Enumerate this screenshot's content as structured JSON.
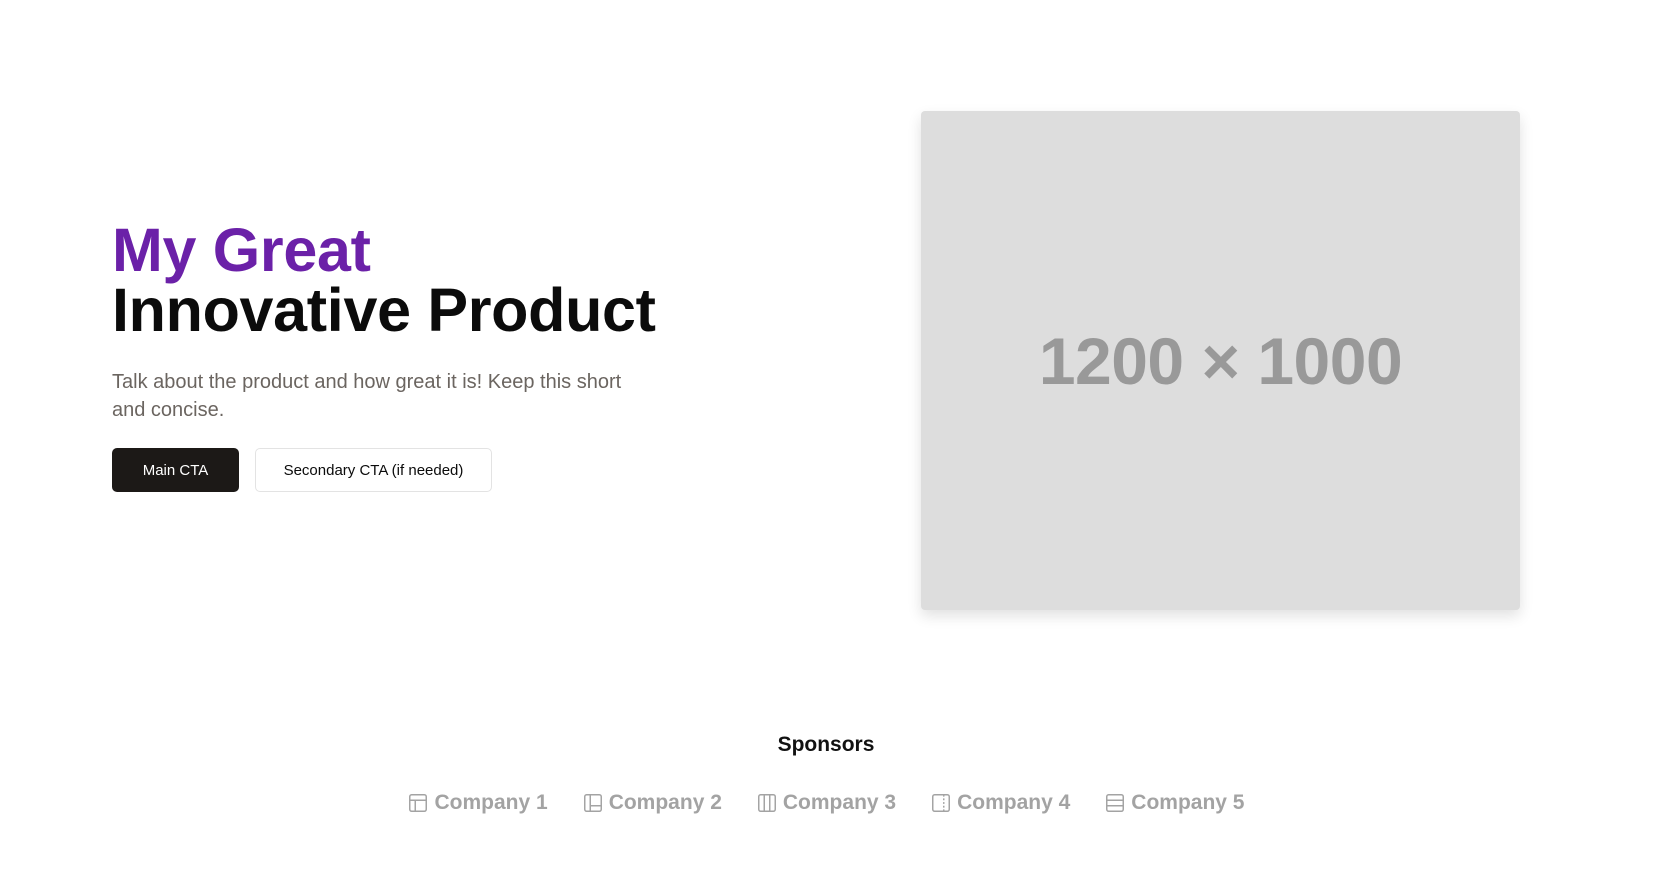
{
  "hero": {
    "title_accent": "My Great",
    "title_main": "Innovative Product",
    "description": "Talk about the product and how great it is! Keep this short and concise.",
    "main_cta_label": "Main CTA",
    "secondary_cta_label": "Secondary CTA (if needed)",
    "image_placeholder_label": "1200 × 1000"
  },
  "sponsors": {
    "title": "Sponsors",
    "items": [
      {
        "label": "Company 1",
        "icon": "layout-icon"
      },
      {
        "label": "Company 2",
        "icon": "layout-sidebar-icon"
      },
      {
        "label": "Company 3",
        "icon": "columns-icon"
      },
      {
        "label": "Company 4",
        "icon": "sidebar-right-icon"
      },
      {
        "label": "Company 5",
        "icon": "rows-icon"
      }
    ]
  },
  "colors": {
    "accent": "#6b21a8",
    "primary_button": "#1c1917",
    "muted_text": "#6b6560",
    "sponsor_text": "#a3a3a3",
    "placeholder_bg": "#dddddd"
  }
}
